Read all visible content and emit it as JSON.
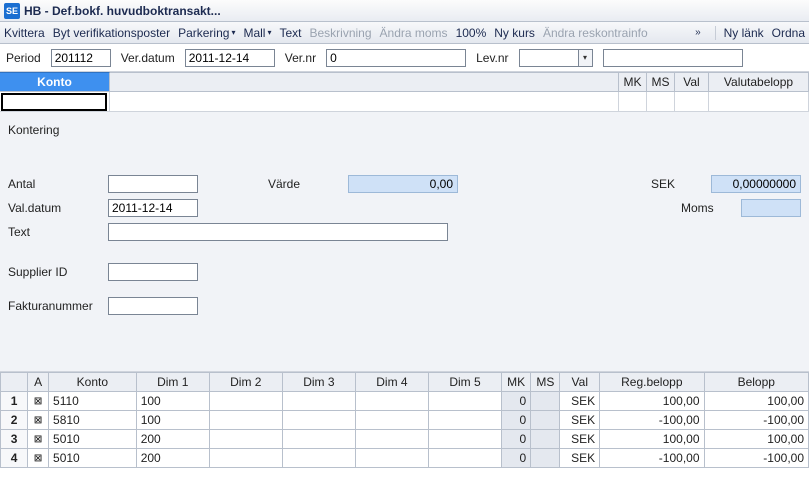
{
  "titlebar": {
    "badge": "SE",
    "title": "HB - Def.bokf. huvudboktransakt..."
  },
  "toolbar": {
    "kvittera": "Kvittera",
    "byt": "Byt verifikationsposter",
    "parkering": "Parkering",
    "mall": "Mall",
    "text": "Text",
    "beskrivning": "Beskrivning",
    "andramoms": "Ändra moms",
    "hundra": "100%",
    "nykurs": "Ny kurs",
    "reskontra": "Ändra reskontrainfo",
    "overflow": "»",
    "nylank": "Ny länk",
    "ordna": "Ordna"
  },
  "formbar": {
    "period_label": "Period",
    "period": "201112",
    "verdatum_label": "Ver.datum",
    "verdatum": "2011-12-14",
    "vernr_label": "Ver.nr",
    "vernr": "0",
    "levnr_label": "Lev.nr"
  },
  "gridhead": {
    "konto": "Konto",
    "mk": "MK",
    "ms": "MS",
    "val": "Val",
    "vb": "Valutabelopp"
  },
  "panel": {
    "kontering": "Kontering",
    "antal": "Antal",
    "varde": "Värde",
    "varde_val": "0,00",
    "sek": "SEK",
    "sek_val": "0,00000000",
    "valdatum": "Val.datum",
    "valdatum_val": "2011-12-14",
    "moms": "Moms",
    "text": "Text",
    "supplier": "Supplier ID",
    "faktura": "Fakturanummer"
  },
  "table": {
    "headers": {
      "a": "A",
      "konto": "Konto",
      "dim1": "Dim 1",
      "dim2": "Dim 2",
      "dim3": "Dim 3",
      "dim4": "Dim 4",
      "dim5": "Dim 5",
      "mk": "MK",
      "ms": "MS",
      "val": "Val",
      "reg": "Reg.belopp",
      "belopp": "Belopp"
    },
    "rows": [
      {
        "n": "1",
        "konto": "5110",
        "dim1": "100",
        "mk": "0",
        "val": "SEK",
        "reg": "100,00",
        "belopp": "100,00",
        "neg": false
      },
      {
        "n": "2",
        "konto": "5810",
        "dim1": "100",
        "mk": "0",
        "val": "SEK",
        "reg": "-100,00",
        "belopp": "-100,00",
        "neg": true
      },
      {
        "n": "3",
        "konto": "5010",
        "dim1": "200",
        "mk": "0",
        "val": "SEK",
        "reg": "100,00",
        "belopp": "100,00",
        "neg": false
      },
      {
        "n": "4",
        "konto": "5010",
        "dim1": "200",
        "mk": "0",
        "val": "SEK",
        "reg": "-100,00",
        "belopp": "-100,00",
        "neg": true
      }
    ]
  }
}
